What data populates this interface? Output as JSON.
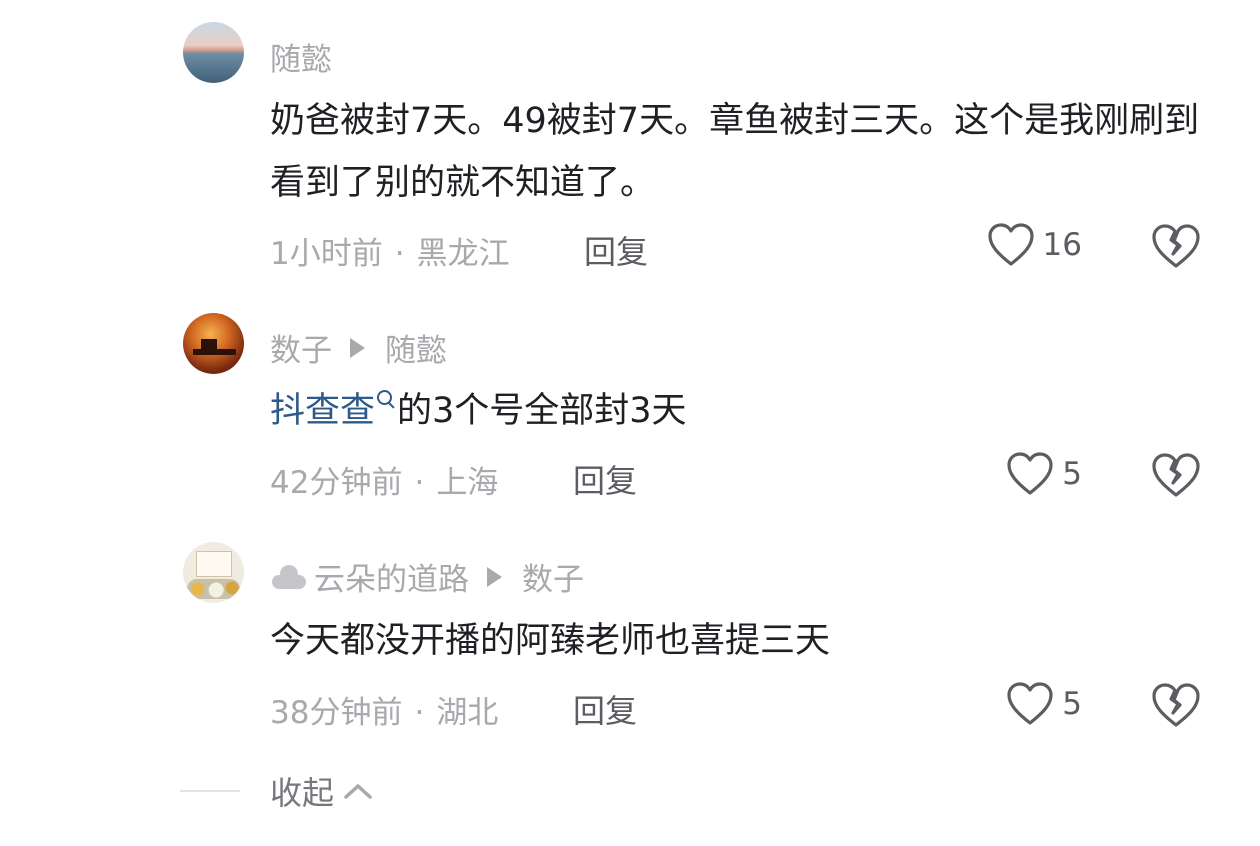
{
  "comments": [
    {
      "author": "随懿",
      "text": "奶爸被封7天。49被封7天。章鱼被封三天。这个是我刚刷到看到了别的就不知道了。",
      "time": "1小时前",
      "location": "黑龙江",
      "reply_label": "回复",
      "likes": "16"
    },
    {
      "author": "数子",
      "reply_to": "随懿",
      "mention": "抖查查",
      "text": "的3个号全部封3天",
      "time": "42分钟前",
      "location": "上海",
      "reply_label": "回复",
      "likes": "5"
    },
    {
      "author": "云朵的道路",
      "reply_to": "数子",
      "text": "今天都没开播的阿臻老师也喜提三天",
      "time": "38分钟前",
      "location": "湖北",
      "reply_label": "回复",
      "likes": "5"
    }
  ],
  "separator": "·",
  "collapse_label": "收起",
  "icons": {
    "like": "heart-outline-icon",
    "dislike": "broken-heart-icon",
    "reply_arrow": "play-triangle-icon",
    "collapse": "chevron-up-icon",
    "mention_search": "search-icon",
    "author_badge": "cloud-icon"
  },
  "colors": {
    "text": "#1f1f24",
    "muted": "#a8a8ad",
    "mention": "#2d5a8a",
    "icon": "#5c5c63"
  }
}
